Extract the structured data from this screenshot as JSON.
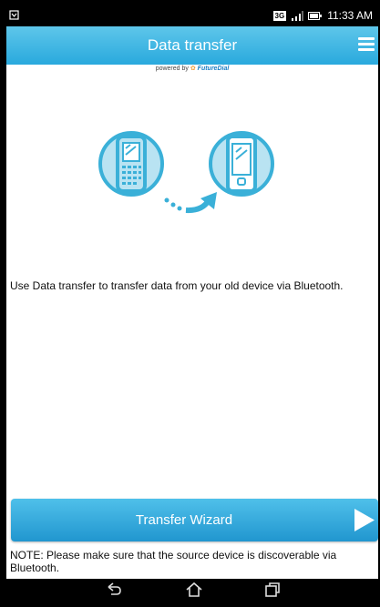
{
  "status_bar": {
    "network": "3G",
    "time": "11:33 AM"
  },
  "header": {
    "title": "Data transfer",
    "menu_icon": "menu-icon"
  },
  "powered_by": {
    "prefix": "powered by",
    "brand": "FutureDial"
  },
  "illustration": {
    "left_icon": "old-phone-icon",
    "right_icon": "smartphone-icon",
    "arrow_icon": "transfer-arrow-icon"
  },
  "main": {
    "description": "Use Data transfer to transfer data from your old device via Bluetooth."
  },
  "wizard_button": {
    "label": "Transfer Wizard"
  },
  "note": "NOTE: Please make sure that the source device is discoverable via Bluetooth.",
  "nav": {
    "back_icon": "back-icon",
    "home_icon": "home-icon",
    "recents_icon": "recent-apps-icon"
  },
  "colors": {
    "accent": "#29a9dd",
    "illustration": "#3ab0d8"
  }
}
